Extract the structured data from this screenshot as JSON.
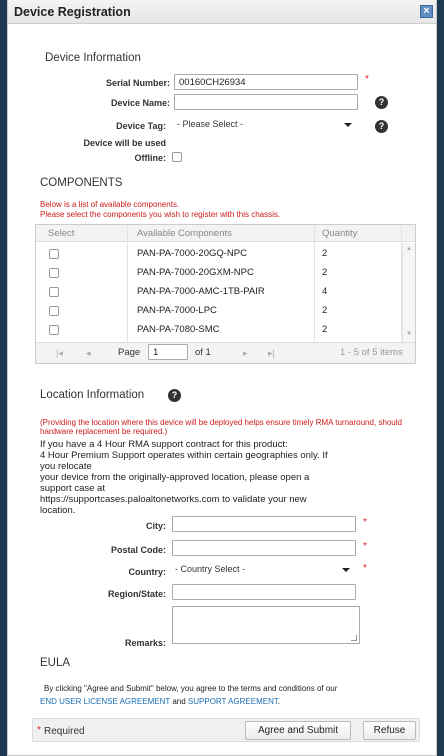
{
  "dialog": {
    "title": "Device Registration",
    "close_glyph": "×"
  },
  "device_info": {
    "heading": "Device Information",
    "serial_label": "Serial Number:",
    "serial_value": "00160CH26934",
    "required_mark": "*",
    "name_label": "Device Name:",
    "name_value": "",
    "tag_label": "Device Tag:",
    "tag_selected": "- Please Select -",
    "used_offline_line1": "Device will be used",
    "offline_label": "Offline:",
    "help_glyph": "?"
  },
  "components": {
    "heading": "COMPONENTS",
    "note1": "Below is a list of available components.",
    "note2": "Please select the components you wish to register with this chassis.",
    "columns": [
      "Select",
      "Available Components",
      "Quantity"
    ],
    "rows": [
      {
        "name": "PAN-PA-7000-20GQ-NPC",
        "qty": "2"
      },
      {
        "name": "PAN-PA-7000-20GXM-NPC",
        "qty": "2"
      },
      {
        "name": "PAN-PA-7000-AMC-1TB-PAIR",
        "qty": "4"
      },
      {
        "name": "PAN-PA-7000-LPC",
        "qty": "2"
      },
      {
        "name": "PAN-PA-7080-SMC",
        "qty": "2"
      }
    ],
    "pager": {
      "page_label": "Page",
      "page_value": "1",
      "of_label": "of 1",
      "range": "1 - 5 of 5 items",
      "first": "|◂",
      "prev": "◂",
      "next": "▸",
      "last": "▸|"
    }
  },
  "location": {
    "heading": "Location Information",
    "warning": "(Providing the location where this device will be deployed helps ensure timely RMA turnaround, should hardware replacement be required.)",
    "para_lines": [
      "If you have a 4 Hour RMA support contract for this product:",
      "4 Hour Premium Support operates within certain geographies only. If",
      "you relocate",
      "your device from the originally-approved location, please open a",
      "support case at",
      "https://supportcases.paloaltonetworks.com to validate your new",
      "location."
    ],
    "city_label": "City:",
    "postal_label": "Postal Code:",
    "country_label": "Country:",
    "country_selected": "- Country Select -",
    "region_label": "Region/State:",
    "remarks_label": "Remarks:"
  },
  "eula": {
    "heading": "EULA",
    "text_pre": "By clicking \"Agree and Submit\" below, you agree to the terms and conditions of our",
    "link1": "END USER LICENSE AGREEMENT",
    "and": " and ",
    "link2": "SUPPORT AGREEMENT",
    "period": "."
  },
  "footer": {
    "required_note": "Required",
    "agree_button": "Agree and Submit",
    "refuse_button": "Refuse"
  },
  "colors": {
    "accent": "#1a6fb5",
    "required": "#e02020",
    "backdrop": "#1d3a52"
  }
}
